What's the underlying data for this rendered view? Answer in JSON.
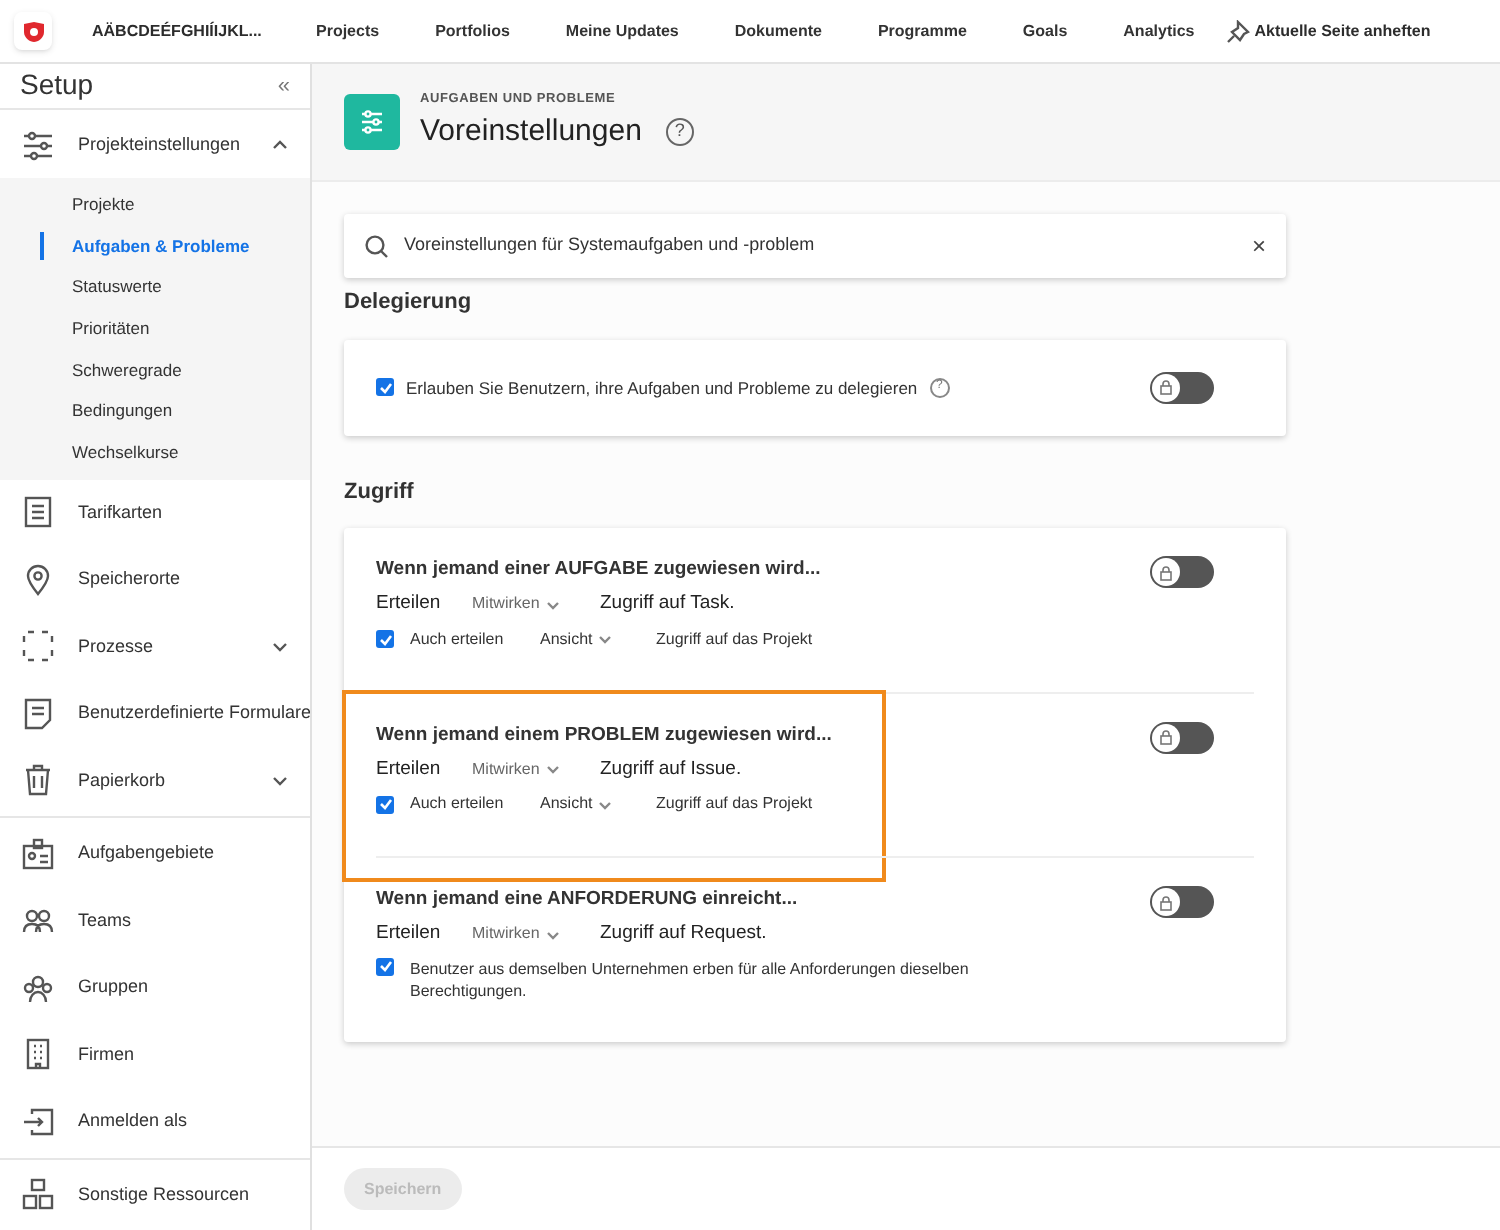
{
  "topnav": {
    "account": "AÄBCDEÉFGHIÍIJKL...",
    "links": [
      "Projects",
      "Portfolios",
      "Meine Updates",
      "Dokumente",
      "Programme",
      "Goals",
      "Analytics"
    ],
    "pin": "Aktuelle Seite anheften"
  },
  "sidebar": {
    "title": "Setup",
    "collapse": "«",
    "groups": [
      [
        {
          "label": "Projekteinstellungen",
          "expanded": true,
          "children": [
            {
              "label": "Projekte",
              "selected": false
            },
            {
              "label": "Aufgaben & Probleme",
              "selected": true
            },
            {
              "label": "Statuswerte",
              "selected": false
            },
            {
              "label": "Prioritäten",
              "selected": false
            },
            {
              "label": "Schweregrade",
              "selected": false
            },
            {
              "label": "Bedingungen",
              "selected": false
            },
            {
              "label": "Wechselkurse",
              "selected": false
            }
          ]
        },
        {
          "label": "Tarifkarten"
        },
        {
          "label": "Speicherorte"
        },
        {
          "label": "Prozesse",
          "expanded": false
        },
        {
          "label": "Benutzerdefinierte Formulare"
        },
        {
          "label": "Papierkorb",
          "expanded": false
        }
      ],
      [
        {
          "label": "Aufgabengebiete"
        },
        {
          "label": "Teams"
        },
        {
          "label": "Gruppen"
        },
        {
          "label": "Firmen"
        },
        {
          "label": "Anmelden als"
        }
      ],
      [
        {
          "label": "Sonstige Ressourcen"
        }
      ]
    ]
  },
  "header": {
    "eyebrow": "AUFGABEN UND PROBLEME",
    "title": "Voreinstellungen",
    "help": "?"
  },
  "search": {
    "value": "Voreinstellungen für Systemaufgaben und -problem",
    "clear": "×"
  },
  "sections": [
    {
      "heading": "Delegierung",
      "rules": [
        {
          "kind": "checkbox",
          "label": "Erlauben Sie Benutzern, ihre Aufgaben und Probleme zu delegieren",
          "help": "?",
          "checked": true,
          "on": false,
          "highlighted": false
        }
      ]
    },
    {
      "heading": "Zugriff",
      "rules": [
        {
          "kind": "access",
          "title": "Wenn jemand einer AUFGABE zugewiesen wird...",
          "grant": "Erteilen",
          "level": "Mitwirken",
          "object": "Zugriff auf Task.",
          "on": false,
          "highlighted": false,
          "sub": {
            "kind": "access",
            "checked": true,
            "label": "Auch erteilen",
            "level": "Ansicht",
            "object": "Zugriff auf das Projekt"
          }
        },
        {
          "kind": "access",
          "title": "Wenn jemand einem PROBLEM zugewiesen wird...",
          "grant": "Erteilen",
          "level": "Mitwirken",
          "object": "Zugriff auf Issue.",
          "on": false,
          "highlighted": true,
          "sub": {
            "kind": "access",
            "checked": true,
            "label": "Auch erteilen",
            "level": "Ansicht",
            "object": "Zugriff auf das Projekt"
          }
        },
        {
          "kind": "access",
          "title": "Wenn jemand eine ANFORDERUNG einreicht...",
          "grant": "Erteilen",
          "level": "Mitwirken",
          "object": "Zugriff auf Request.",
          "on": false,
          "highlighted": false,
          "sub": {
            "kind": "inherit",
            "checked": true,
            "label": "Benutzer aus demselben Unternehmen erben für alle Anforderungen dieselben Berechtigungen."
          }
        }
      ]
    }
  ],
  "save": {
    "label": "Speichern",
    "disabled": true
  }
}
